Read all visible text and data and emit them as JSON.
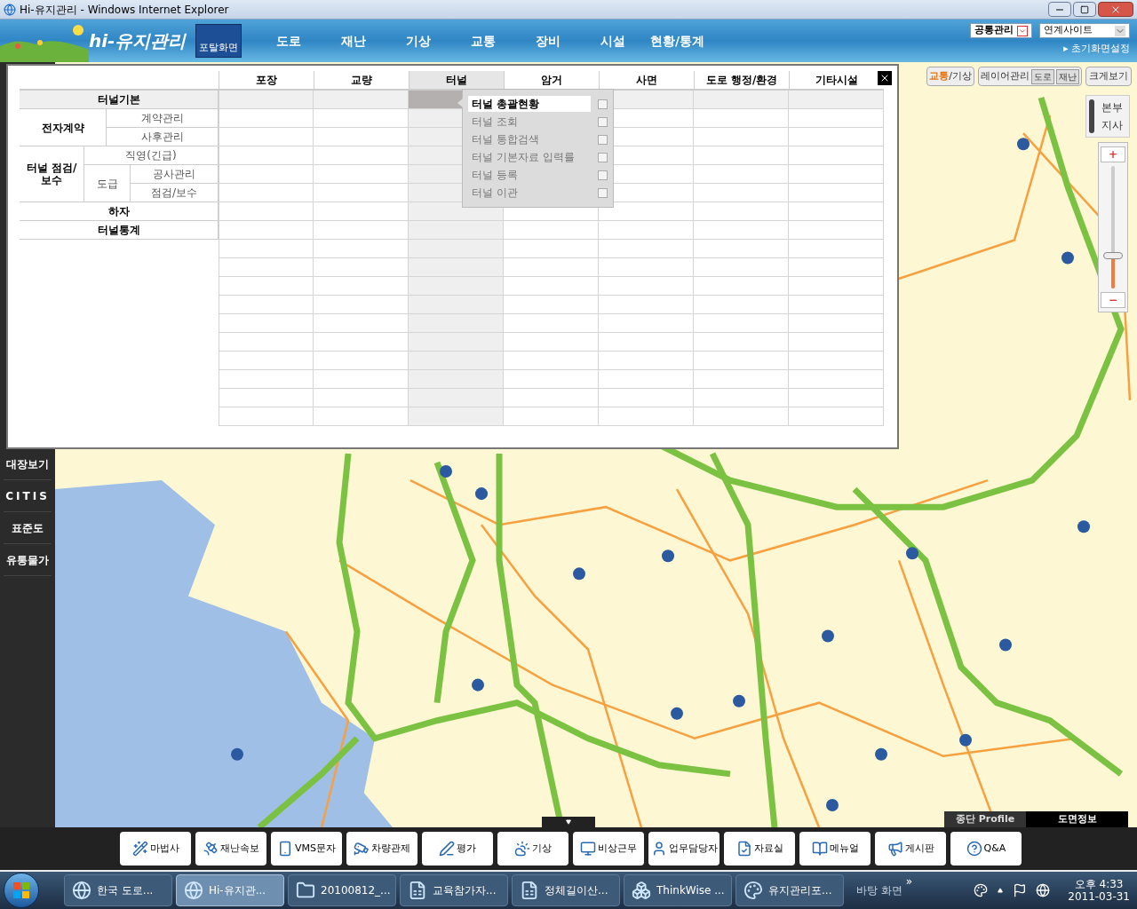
{
  "window": {
    "title": "Hi-유지관리 - Windows Internet Explorer"
  },
  "header": {
    "logo": "hi-유지관리",
    "portal_button": "포탈화면",
    "nav": [
      "도로",
      "재난",
      "기상",
      "교통",
      "장비",
      "시설",
      "현황/통계"
    ],
    "common_select": "공통관리",
    "links_select": "연계사이트",
    "home_setting_marker": "▸",
    "home_setting": "초기화면설정"
  },
  "sidebar": {
    "items": [
      "대장보기",
      "CITIS",
      "표준도",
      "유통물가"
    ]
  },
  "panel": {
    "columns": [
      {
        "label": "포장",
        "selected": false
      },
      {
        "label": "교량",
        "selected": false
      },
      {
        "label": "터널",
        "selected": true
      },
      {
        "label": "암거",
        "selected": false
      },
      {
        "label": "사면",
        "selected": false
      },
      {
        "label": "도로 행정/환경",
        "selected": false
      },
      {
        "label": "기타시설",
        "selected": false
      }
    ],
    "menu_rows": [
      {
        "label": "터널기본",
        "kind": "section"
      },
      {
        "label": "전자계약",
        "kind": "entry",
        "children": [
          {
            "label": "계약관리"
          },
          {
            "label": "사후관리"
          }
        ]
      },
      {
        "label": "터널 점검/보수",
        "kind": "entry",
        "children": [
          {
            "label": "직영(긴급)"
          },
          {
            "label": "도급",
            "children": [
              {
                "label": "공사관리"
              },
              {
                "label": "점검/보수"
              }
            ]
          }
        ]
      },
      {
        "label": "하자",
        "kind": "entry"
      },
      {
        "label": "터널통계",
        "kind": "entry"
      }
    ],
    "dropdown": {
      "items": [
        {
          "label": "터널 총괄현황",
          "selected": true,
          "checked": false
        },
        {
          "label": "터널 조회",
          "selected": false,
          "checked": false
        },
        {
          "label": "터널 통합검색",
          "selected": false,
          "checked": false
        },
        {
          "label": "터널 기본자료 입력률",
          "selected": false,
          "checked": false
        },
        {
          "label": "터널 등록",
          "selected": false,
          "checked": false
        },
        {
          "label": "터널 이관",
          "selected": false,
          "checked": false
        }
      ]
    }
  },
  "map_tools": {
    "mode_toggle": {
      "options": [
        {
          "label": "교통",
          "selected": true
        },
        {
          "label": "기상",
          "selected": false
        }
      ],
      "separator": "/"
    },
    "layer_button": "레이어관리",
    "layer_options": [
      "도로",
      "재난"
    ],
    "enlarge_button": "크게보기",
    "office_toggle": [
      "본부",
      "지사"
    ],
    "zoom": {
      "level": 0.27,
      "in_label": "+",
      "out_label": "−"
    }
  },
  "bottom_tabs": [
    {
      "label": "종단 Profile",
      "selected": false
    },
    {
      "label": "도면정보",
      "selected": true
    }
  ],
  "toolbar": [
    "마법사",
    "재난속보",
    "VMS문자",
    "차량관제",
    "평가",
    "기상",
    "비상근무",
    "업무담당자",
    "자료실",
    "메뉴얼",
    "게시판",
    "Q&A"
  ],
  "taskbar": {
    "tasks": [
      {
        "label": "한국 도로...",
        "selected": false
      },
      {
        "label": "Hi-유지관...",
        "selected": true
      },
      {
        "label": "20100812_...",
        "selected": false
      },
      {
        "label": "교육참가자...",
        "selected": false
      },
      {
        "label": "정체길이산...",
        "selected": false
      },
      {
        "label": "ThinkWise ...",
        "selected": false
      },
      {
        "label": "유지관리포...",
        "selected": false
      }
    ],
    "desktop": "바탕 화면",
    "more": "»",
    "time": "오후 4:33",
    "date": "2011-03-31"
  }
}
